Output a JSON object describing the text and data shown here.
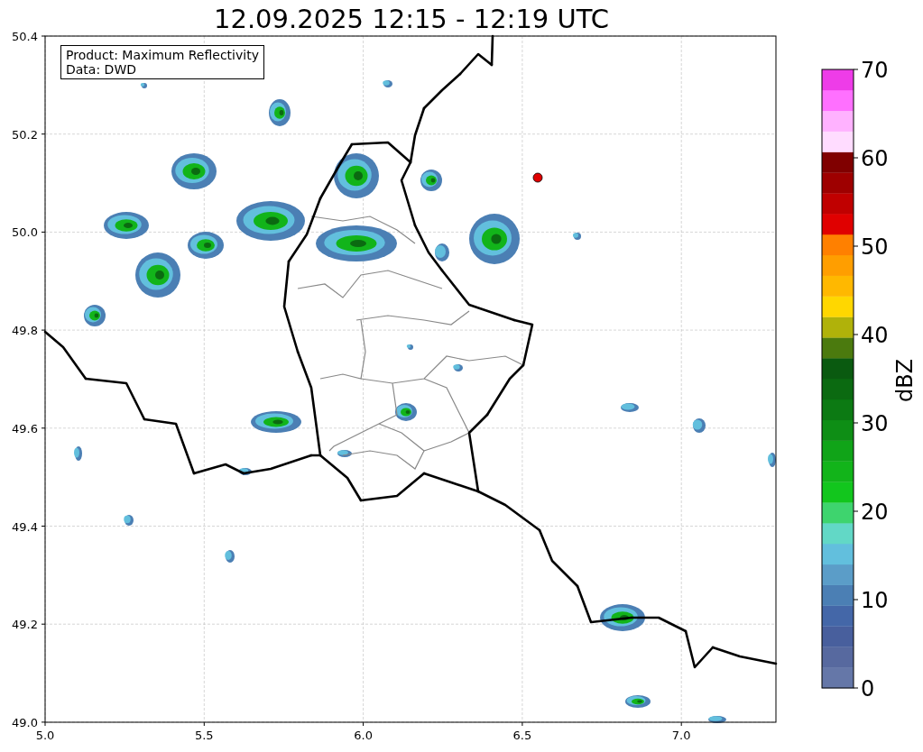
{
  "title": "12.09.2025 12:15 - 12:19 UTC",
  "info_box": [
    "Product: Maximum Reflectivity",
    "Data: DWD"
  ],
  "map": {
    "x_ticks": [
      "5.0",
      "5.5",
      "6.0",
      "6.5",
      "7.0"
    ],
    "y_ticks": [
      "50.4",
      "50.2",
      "50.0",
      "49.8",
      "49.6",
      "49.4",
      "49.2",
      "49.0"
    ]
  },
  "colorbar": {
    "label": "dBZ",
    "ticks": [
      "70",
      "60",
      "50",
      "40",
      "30",
      "20",
      "10",
      "0"
    ],
    "segments": [
      {
        "color": "#6577a8"
      },
      {
        "color": "#57699f"
      },
      {
        "color": "#485f9d"
      },
      {
        "color": "#4467a8"
      },
      {
        "color": "#4b7fb4"
      },
      {
        "color": "#5b9dc8"
      },
      {
        "color": "#62bfdd"
      },
      {
        "color": "#62d8c6"
      },
      {
        "color": "#3ed46e"
      },
      {
        "color": "#12c61d"
      },
      {
        "color": "#12b41a"
      },
      {
        "color": "#10a418"
      },
      {
        "color": "#0e8e15"
      },
      {
        "color": "#0c7a13"
      },
      {
        "color": "#0b6a11"
      },
      {
        "color": "#0a5a10"
      },
      {
        "color": "#4b7a0e"
      },
      {
        "color": "#b0b20a"
      },
      {
        "color": "#ffd700"
      },
      {
        "color": "#ffb800"
      },
      {
        "color": "#ff9e00"
      },
      {
        "color": "#ff8000"
      },
      {
        "color": "#e00000"
      },
      {
        "color": "#c00000"
      },
      {
        "color": "#9e0000"
      },
      {
        "color": "#800000"
      },
      {
        "color": "#ffdcff"
      },
      {
        "color": "#ffb2ff"
      },
      {
        "color": "#ff70ff"
      },
      {
        "color": "#ee3ce8"
      }
    ]
  }
}
